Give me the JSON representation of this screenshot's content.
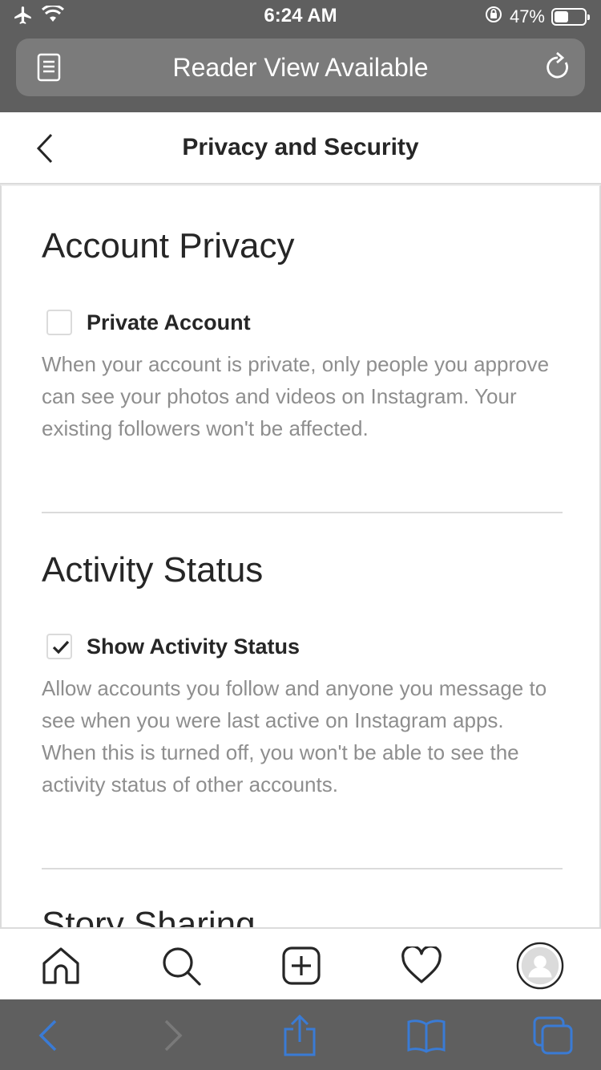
{
  "status_bar": {
    "time": "6:24 AM",
    "battery_percent": "47%",
    "battery_level": 0.47
  },
  "browser": {
    "address_text": "Reader View Available"
  },
  "header": {
    "title": "Privacy and Security"
  },
  "sections": {
    "account_privacy": {
      "title": "Account Privacy",
      "option_label": "Private Account",
      "checked": false,
      "description": "When your account is private, only people you approve can see your photos and videos on Instagram. Your existing followers won't be affected."
    },
    "activity_status": {
      "title": "Activity Status",
      "option_label": "Show Activity Status",
      "checked": true,
      "description": "Allow accounts you follow and anyone you message to see when you were last active on Instagram apps. When this is turned off, you won't be able to see the activity status of other accounts."
    },
    "story_sharing": {
      "title": "Story Sharing"
    }
  },
  "tab_bar": {
    "items": [
      "home-icon",
      "search-icon",
      "new-post-icon",
      "activity-heart-icon",
      "profile-avatar"
    ]
  },
  "safari_toolbar": {
    "items": [
      "back-icon",
      "forward-icon",
      "share-icon",
      "bookmarks-icon",
      "tabs-icon"
    ],
    "accent_color": "#3a7bd5"
  }
}
